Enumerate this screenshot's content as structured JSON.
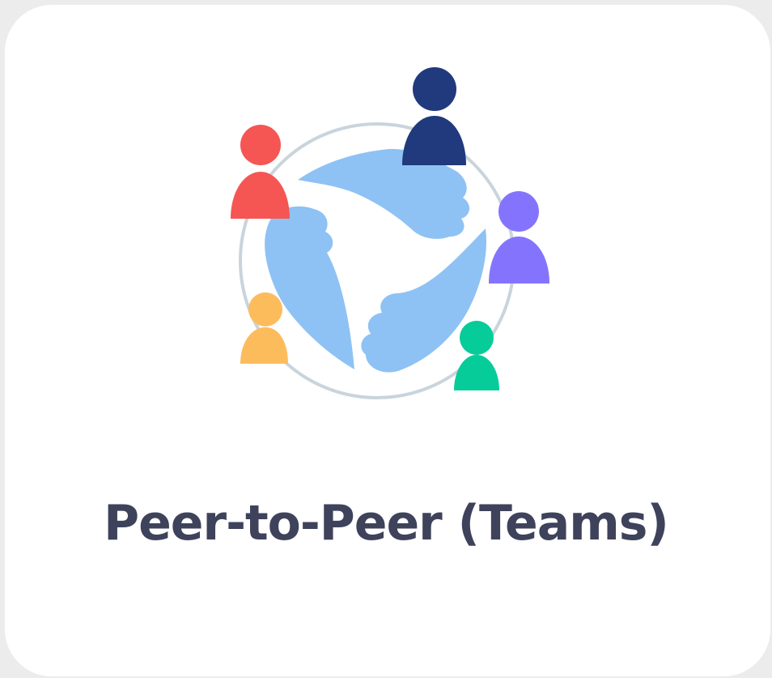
{
  "card": {
    "title": "Peer-to-Peer (Teams)",
    "icon": "peer-to-peer-teams-icon"
  },
  "colors": {
    "title_text": "#3e425b",
    "circle_ring": "#c9d4dc",
    "hands": "#8ec2f4",
    "person_red": "#f55653",
    "person_navy": "#213a7d",
    "person_purple": "#8474fd",
    "person_green": "#06cc99",
    "person_orange": "#fdbc5c"
  }
}
